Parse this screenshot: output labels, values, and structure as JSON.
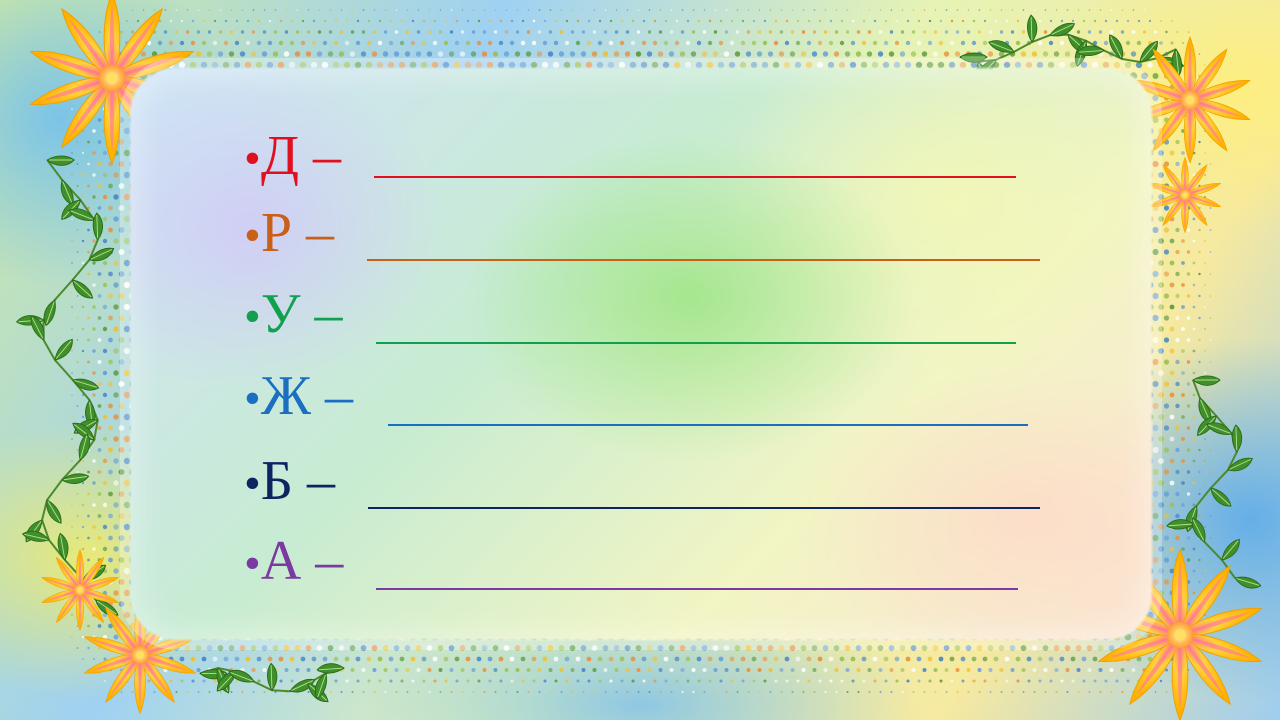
{
  "items": [
    {
      "bullet": "•",
      "letter": "Д",
      "dash": " –",
      "color": "#e01020"
    },
    {
      "bullet": "•",
      "letter": "Р",
      "dash": " –",
      "color": "#c86018"
    },
    {
      "bullet": "•",
      "letter": "У",
      "dash": " –",
      "color": "#10a050"
    },
    {
      "bullet": "•",
      "letter": "Ж",
      "dash": " –",
      "color": "#1a6fc0"
    },
    {
      "bullet": "•",
      "letter": "Б",
      "dash": " –",
      "color": "#0c2460"
    },
    {
      "bullet": "•",
      "letter": "А",
      "dash": " –",
      "color": "#7a3aa0"
    }
  ],
  "decor": {
    "flower_icon": "flower-icon",
    "leaf_icon": "leaf-icon"
  }
}
